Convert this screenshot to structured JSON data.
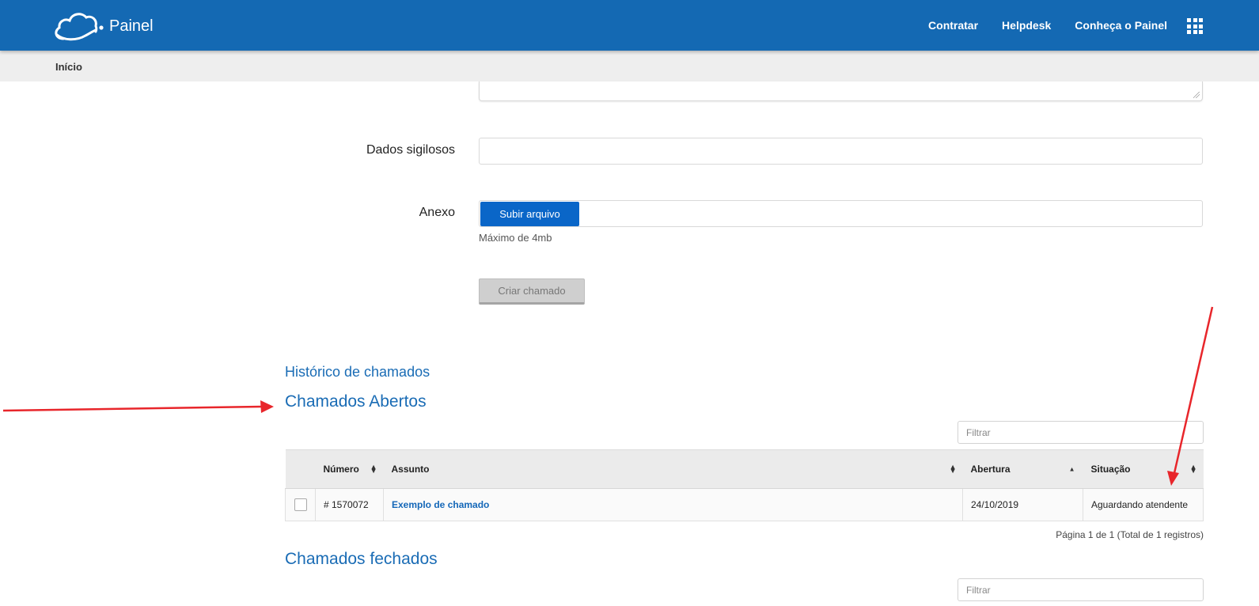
{
  "header": {
    "brand": "Painel",
    "nav": [
      {
        "label": "Contratar"
      },
      {
        "label": "Helpdesk"
      },
      {
        "label": "Conheça o Painel"
      }
    ]
  },
  "breadcrumb": {
    "home": "Início"
  },
  "form": {
    "confidential_label": "Dados sigilosos",
    "confidential_value": "",
    "attachment_label": "Anexo",
    "upload_label": "Subir arquivo",
    "max_size_hint": "Máximo de 4mb",
    "submit_label": "Criar chamado"
  },
  "history": {
    "title": "Histórico de chamados",
    "open": {
      "title": "Chamados Abertos",
      "filter_placeholder": "Filtrar",
      "columns": [
        "Número",
        "Assunto",
        "Abertura",
        "Situação"
      ],
      "rows": [
        {
          "number": "# 1570072",
          "subject": "Exemplo de chamado",
          "opened": "24/10/2019",
          "status": "Aguardando atendente"
        }
      ],
      "pager": "Página 1 de 1 (Total de 1 registros)"
    },
    "closed": {
      "title": "Chamados fechados",
      "filter_placeholder": "Filtrar"
    }
  },
  "colors": {
    "navbar": "#1469b3",
    "link": "#1a6cb5",
    "upload_button": "#0a66c8",
    "annotation": "#e8262b"
  }
}
